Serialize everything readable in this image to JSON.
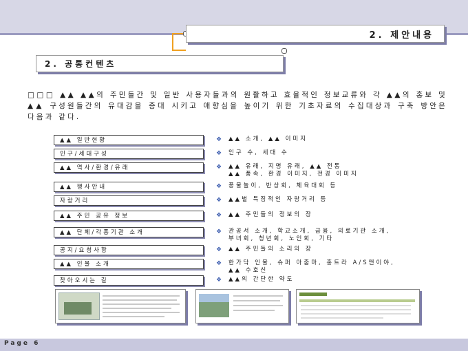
{
  "header": {
    "title": "2. 제안내용",
    "subtitle": "2. 공통컨텐츠"
  },
  "intro": "□□□ ▲▲ ▲▲의 주민들간 및 일반 사용자들과의 원활하고 효율적인 정보교류와 각 ▲▲의 홍보 및 ▲▲ 구성원들간의 유대감을 증대 시키고 애향심을 높이기 위한 기초자료의 수집대상과 구축 방안은 다음과 같다.",
  "rows": [
    {
      "label": "▲▲ 일반현황",
      "text": "▲▲ 소개, ▲▲ 이미지"
    },
    {
      "label": "인구/세대구성",
      "text": "인구 수, 세대 수"
    },
    {
      "label": "▲▲ 역사/환경/유래",
      "text": "▲▲ 유래, 지명 유래, ▲▲ 전통\n▲▲ 풍속, 환경 이미지, 전경 이미지"
    },
    {
      "label": "▲▲ 행사안내",
      "text": "풍물놀이, 반상회, 체육대회 등"
    },
    {
      "label": "자랑거리",
      "text": "▲▲별 특징적인 자랑거리 등"
    },
    {
      "label": "▲▲ 주민 공유 정보",
      "text": "▲▲ 주민들의 정보의 장"
    },
    {
      "label": "▲▲ 단체/각종기관 소개",
      "text": "관공서 소개, 학교소개, 금융, 의료기관 소개,\n부녀회, 청년회, 노인회, 기타"
    },
    {
      "label": "공지/요청사항",
      "text": "▲▲ 주민들의 소리의 장"
    },
    {
      "label": "▲▲ 인물 소개",
      "text": "한가닥 인물, 슈퍼 아줌마, 홍트라 A/S맨이야,\n▲▲ 수호신"
    },
    {
      "label": "찾아오시는 길",
      "text": "▲▲의 간단한 약도"
    }
  ],
  "footer": {
    "page": "Page 6"
  },
  "colors": {
    "band": "#d7d7e6",
    "shadow": "#7d7da8",
    "connector": "#f0a020",
    "bullet": "#3f5fb0"
  }
}
